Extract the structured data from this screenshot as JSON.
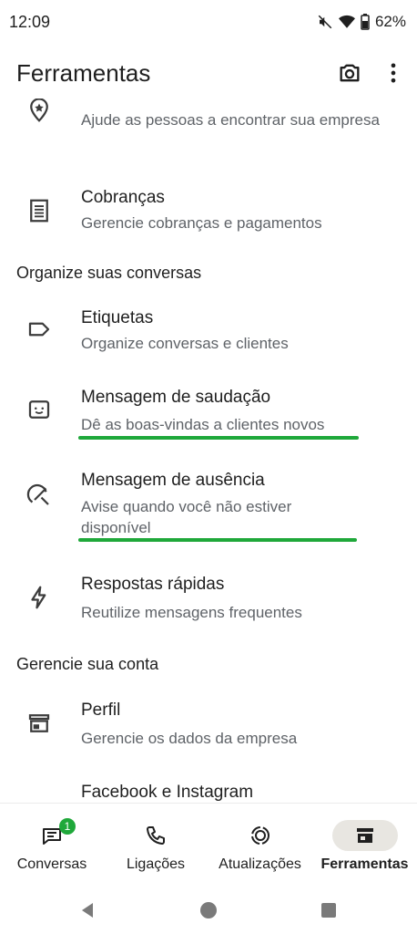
{
  "status": {
    "time": "12:09",
    "battery": "62%"
  },
  "header": {
    "title": "Ferramentas"
  },
  "sections": {
    "organize": "Organize suas conversas",
    "manage": "Gerencie sua conta"
  },
  "items": {
    "catalog_sub": "Ajude as pessoas a encontrar sua empresa",
    "charges": {
      "title": "Cobranças",
      "sub": "Gerencie cobranças e pagamentos"
    },
    "labels": {
      "title": "Etiquetas",
      "sub": "Organize conversas e clientes"
    },
    "greeting": {
      "title": "Mensagem de saudação",
      "sub": "Dê as boas-vindas a clientes novos"
    },
    "away": {
      "title": "Mensagem de ausência",
      "sub": "Avise quando você não estiver disponível"
    },
    "quick": {
      "title": "Respostas rápidas",
      "sub": "Reutilize mensagens frequentes"
    },
    "profile": {
      "title": "Perfil",
      "sub": "Gerencie os dados da empresa"
    },
    "facebook": {
      "title": "Facebook e Instagram"
    }
  },
  "bottom_nav": {
    "chats": "Conversas",
    "chats_badge": "1",
    "calls": "Ligações",
    "updates": "Atualizações",
    "tools": "Ferramentas"
  },
  "colors": {
    "accent": "#1fa83a",
    "text": "#1f1f1f",
    "secondary": "#5f6368"
  },
  "icons": {
    "camera": "camera-icon",
    "menu": "more-vert-icon",
    "badge": "badge-icon",
    "receipt": "receipt-icon",
    "label": "label-icon",
    "greeting": "greeting-icon",
    "away": "away-icon",
    "quick": "flash-icon",
    "store": "store-icon"
  }
}
